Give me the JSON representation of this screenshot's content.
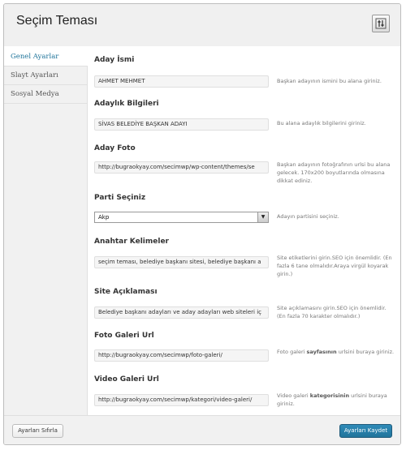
{
  "page": {
    "title": "Seçim Teması"
  },
  "sidebar": {
    "items": [
      {
        "label": "Genel Ayarlar",
        "active": true
      },
      {
        "label": "Slayt Ayarları",
        "active": false
      },
      {
        "label": "Sosyal Medya",
        "active": false
      }
    ]
  },
  "fields": [
    {
      "label": "Aday İsmi",
      "value": "AHMET MEHMET",
      "help": "Başkan adayının ismini bu alana giriniz."
    },
    {
      "label": "Adaylık Bilgileri",
      "value": "SİVAS BELEDİYE BAŞKAN ADAYI",
      "help": "Bu alana adaylık bilgilerini giriniz."
    },
    {
      "label": "Aday Foto",
      "value": "http://bugraokyay.com/secimwp/wp-content/themes/se",
      "help": "Başkan adayının fotoğrafının urlsi bu alana gelecek. 170x200 boyutlarında olmasına dikkat ediniz."
    },
    {
      "label": "Parti Seçiniz",
      "value": "Akp",
      "help": "Adayın partisini seçiniz."
    },
    {
      "label": "Anahtar Kelimeler",
      "value": "seçim teması, belediye başkanı sitesi, belediye başkanı a",
      "help": "Site etiketlerini girin.SEO için önemlidir. (En fazla 6 tane olmalıdır.Araya virgül koyarak girin.)"
    },
    {
      "label": "Site Açıklaması",
      "value": "Belediye başkanı adayları ve aday adayları web siteleri iç",
      "help": "Site açıklamasını girin.SEO için önemlidir. (En fazla 70 karakter olmalıdır.)"
    },
    {
      "label": "Foto Galeri Url",
      "value": "http://bugraokyay.com/secimwp/foto-galeri/",
      "help_pre": "Foto galeri ",
      "help_bold": "sayfasının",
      "help_post": " urlsini buraya giriniz."
    },
    {
      "label": "Video Galeri Url",
      "value": "http://bugraokyay.com/secimwp/kategori/video-galeri/",
      "help_pre": "Video galeri ",
      "help_bold": "kategorisinin",
      "help_post": " urlsini buraya giriniz."
    }
  ],
  "footer": {
    "reset_label": "Ayarları Sıfırla",
    "save_label": "Ayarları Kaydet"
  },
  "colors": {
    "accent": "#21759b",
    "header_bg": "#f0f0f0"
  },
  "icons": {
    "header_button": "settings-icon",
    "select_arrow": "chevron-down-icon"
  }
}
